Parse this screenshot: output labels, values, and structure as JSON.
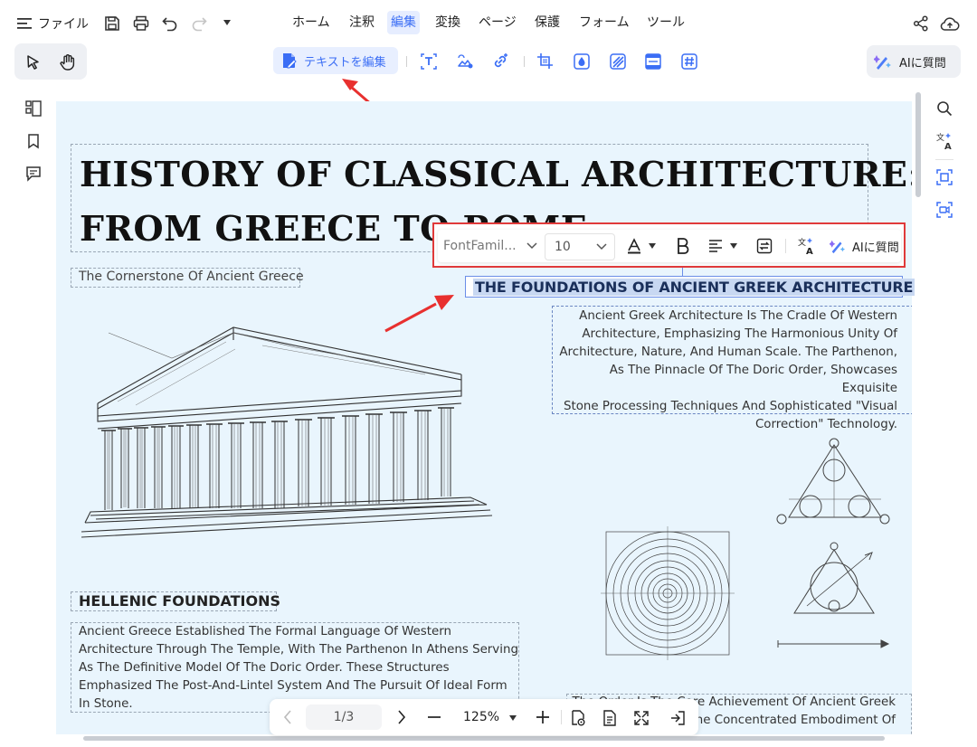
{
  "topbar": {
    "file_label": "ファイル",
    "menus": [
      "ホーム",
      "注釈",
      "編集",
      "変換",
      "ページ",
      "保護",
      "フォーム",
      "ツール"
    ],
    "active_menu": "編集"
  },
  "toolbar": {
    "edit_text_label": "テキストを編集",
    "ai_label": "AIに質問"
  },
  "document": {
    "title_line1": "HISTORY OF CLASSICAL  ARCHITECTURE:",
    "title_line2": "FROM GREECE TO ROME",
    "subtitle": "The Cornerstone Of Ancient Greece",
    "selected_heading": "THE FOUNDATIONS OF ANCIENT GREEK ARCHITECTURE",
    "right_paragraph_lines": [
      "Ancient Greek Architecture Is The Cradle Of Western",
      "Architecture, Emphasizing The Harmonious Unity Of",
      "Architecture, Nature, And Human Scale. The Parthenon,",
      "As The Pinnacle Of The Doric Order, Showcases Exquisite",
      "Stone Processing Techniques And Sophisticated \"Visual",
      "Correction\" Technology."
    ],
    "hellenic_heading": "HELLENIC FOUNDATIONS",
    "left_paragraph_lines": [
      "Ancient Greece Established The Formal Language Of Western",
      "Architecture Through The Temple, With The Parthenon In Athens Serving",
      "As The Definitive Model Of The Doric Order. These Structures",
      "Emphasized The Post-And-Lintel System And The Pursuit Of Ideal Form",
      "In Stone."
    ],
    "bottom_right_lines": [
      "The Order Is The Core Achievement Of Ancient Greek",
      "The Concentrated Embodiment Of"
    ]
  },
  "format_toolbar": {
    "font_family": "FontFamil...",
    "font_size": "10",
    "ai_label": "AIに質問"
  },
  "pager": {
    "page_indicator": "1/3",
    "zoom": "125%"
  },
  "colors": {
    "accent": "#3b6ef5",
    "doc_bg": "#e9f5fd",
    "highlight_border": "#e03a3a"
  }
}
